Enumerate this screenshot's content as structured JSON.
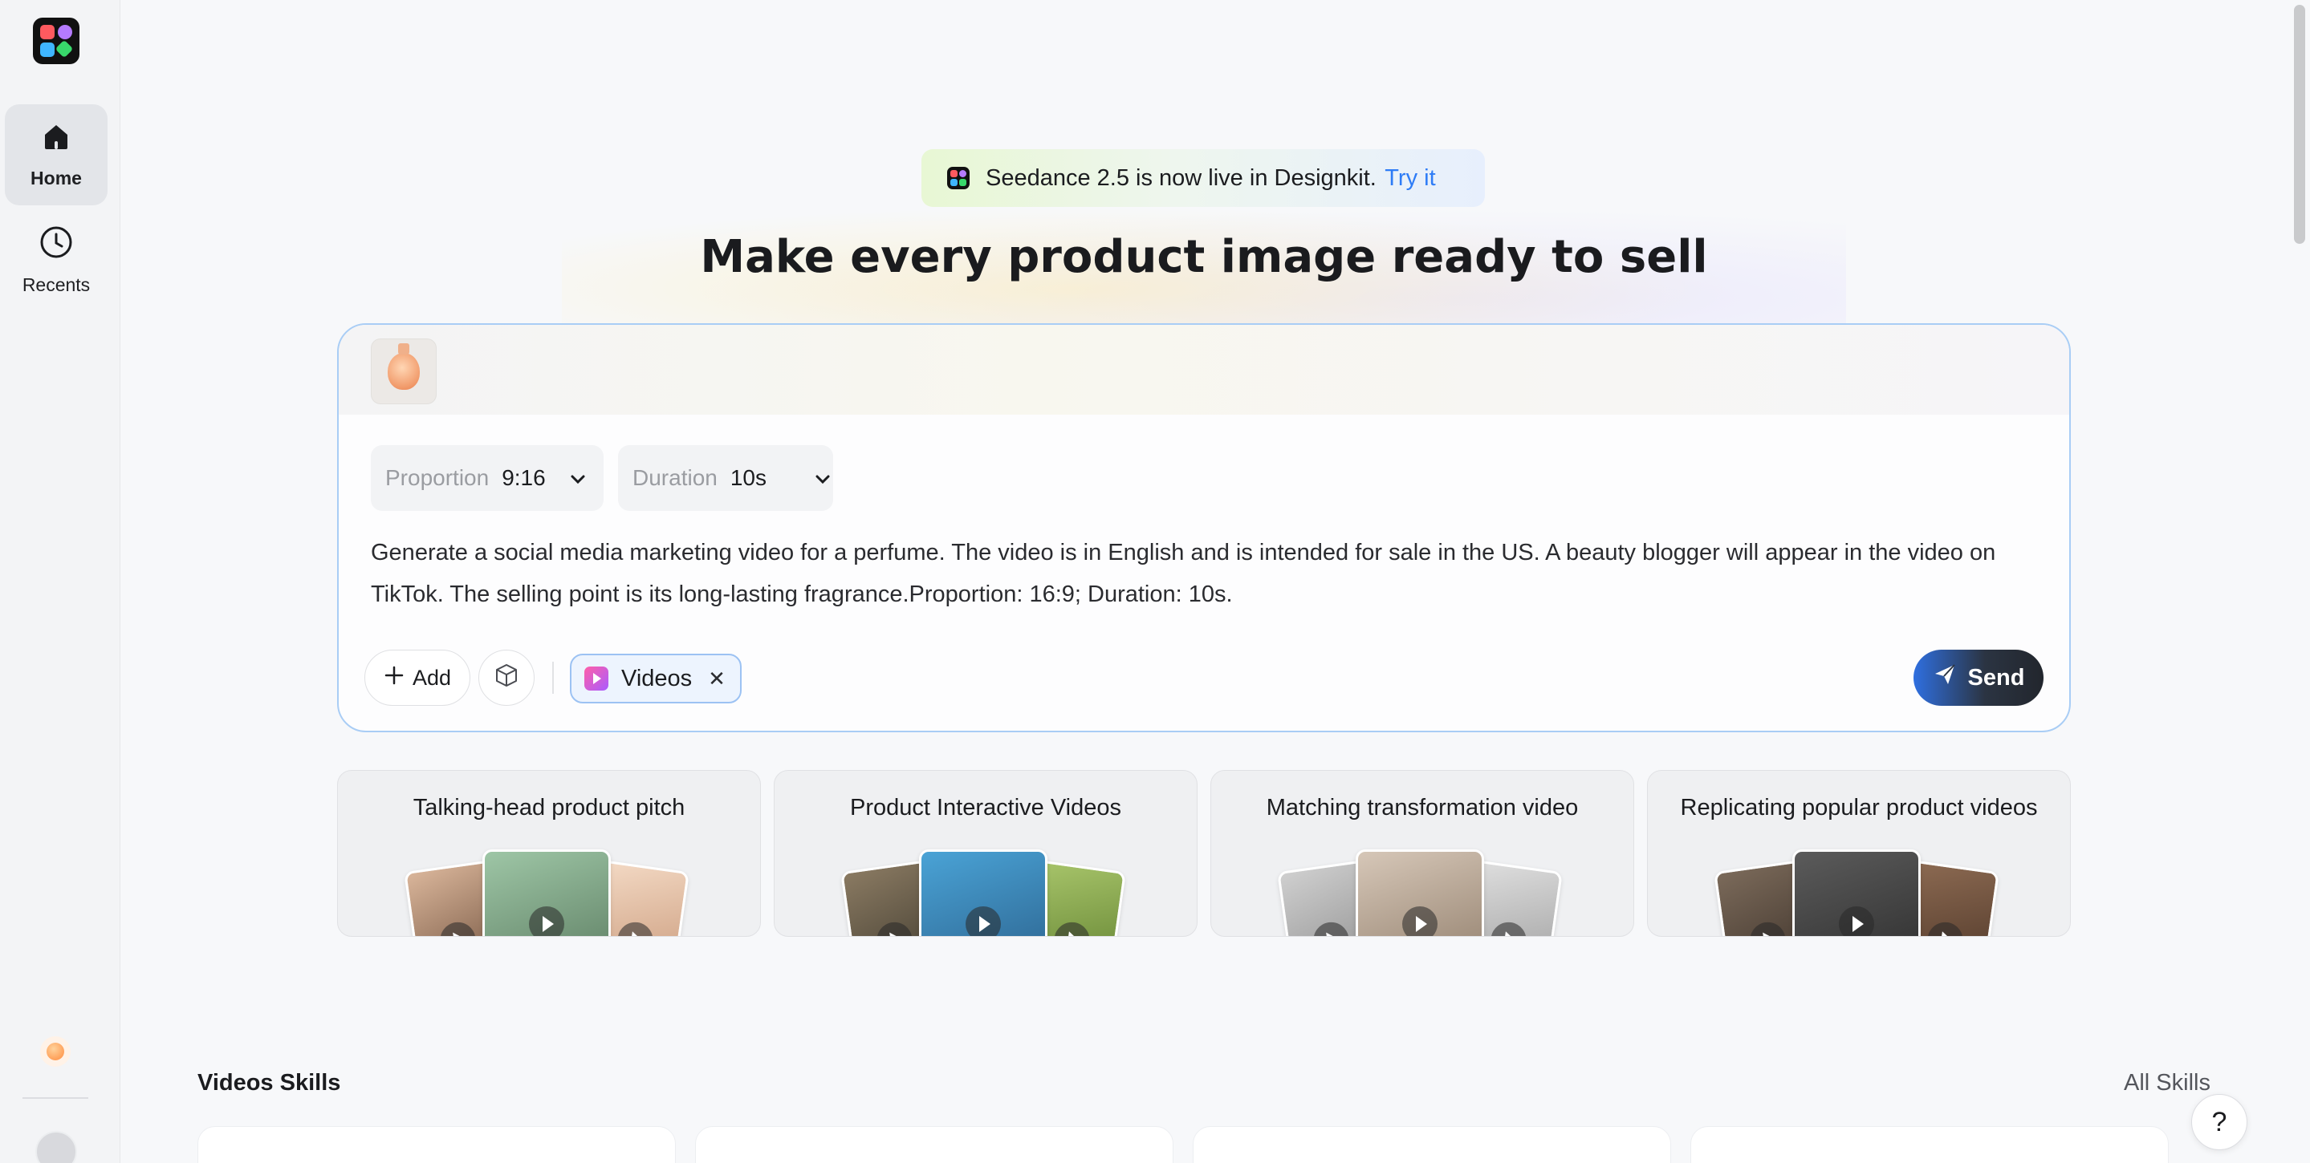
{
  "sidebar": {
    "items": [
      {
        "label": "Home",
        "icon": "home-icon",
        "active": true
      },
      {
        "label": "Recents",
        "icon": "clock-icon",
        "active": false
      }
    ]
  },
  "announcement": {
    "text": "Seedance 2.5 is now live in Designkit.",
    "link": "Try it"
  },
  "headline": "Make every product image ready to sell",
  "composer": {
    "proportion": {
      "label": "Proportion",
      "value": "9:16"
    },
    "duration": {
      "label": "Duration",
      "value": "10s"
    },
    "prompt": "Generate a social media marketing video for a perfume. The video is in English and is intended for sale in the US. A beauty blogger will appear in the video on TikTok. The selling point is its long-lasting fragrance.Proportion: 16:9; Duration: 10s.",
    "add_label": "Add",
    "tag_label": "Videos",
    "send_label": "Send"
  },
  "templates": [
    {
      "title": "Talking-head product pitch"
    },
    {
      "title": "Product Interactive Videos"
    },
    {
      "title": "Matching transformation video"
    },
    {
      "title": "Replicating popular product videos"
    }
  ],
  "skills": {
    "title": "Videos Skills",
    "all_label": "All Skills"
  },
  "help_label": "?",
  "colors": {
    "accent": "#2e7cf6",
    "composer_border": "#a9cdf5",
    "send_dark": "#22262d"
  }
}
